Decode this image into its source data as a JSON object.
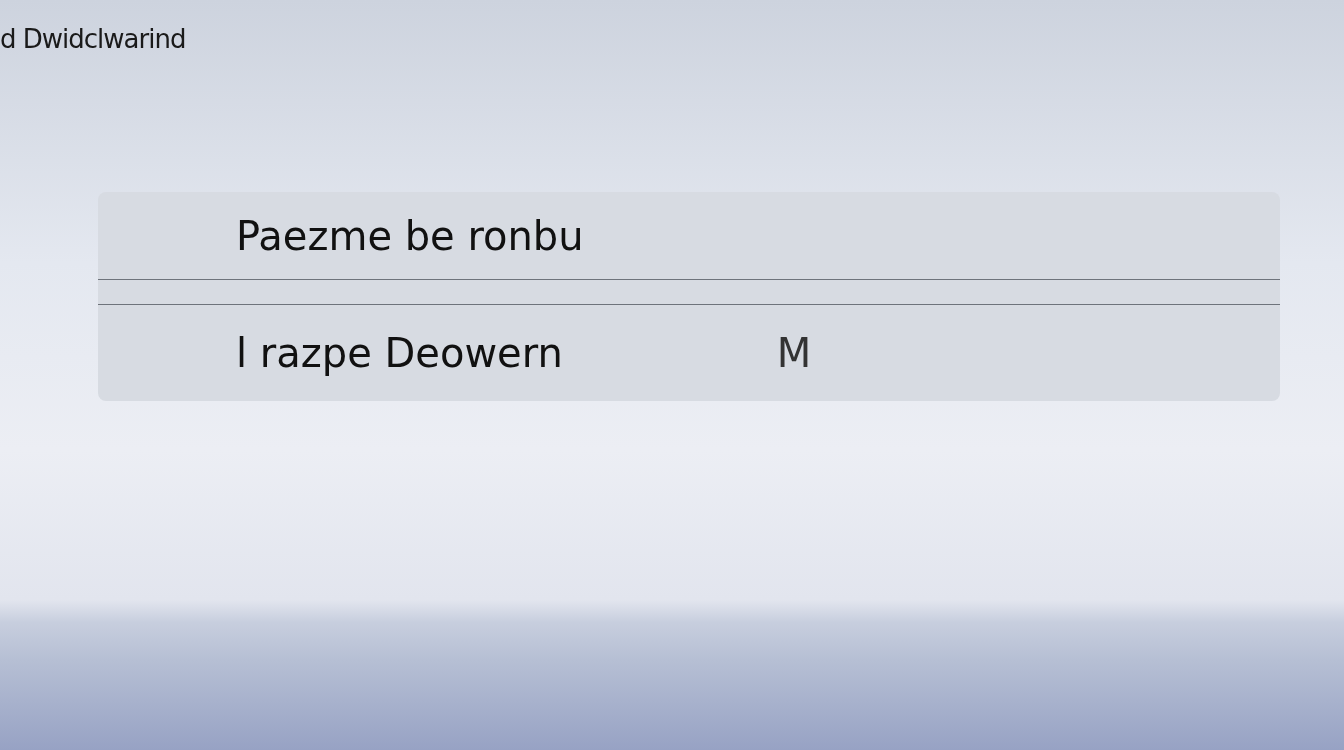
{
  "header": {
    "title": "d Dwidclwarind"
  },
  "panel": {
    "rows": [
      {
        "label": "Paezme be ronbu"
      },
      {
        "label": "l razpe Deowern",
        "value": "M"
      }
    ]
  }
}
